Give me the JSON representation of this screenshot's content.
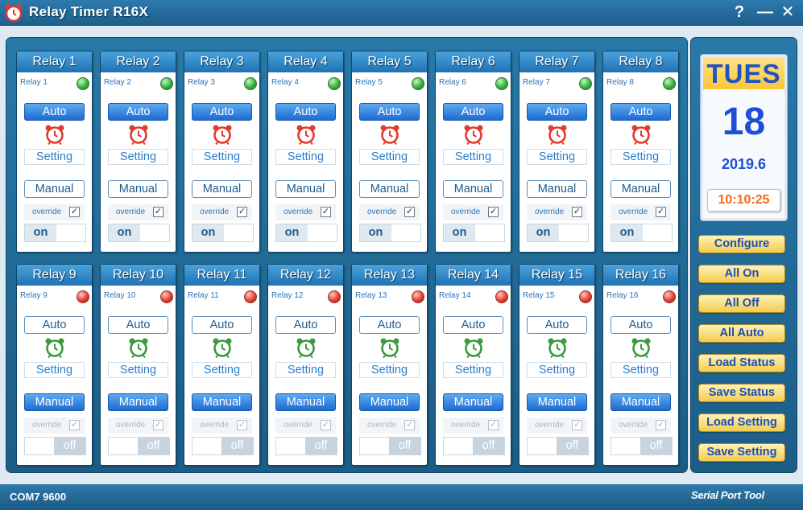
{
  "window": {
    "title": "Relay Timer R16X",
    "help": "?",
    "minimize": "—",
    "close": "✕"
  },
  "relays": [
    {
      "title": "Relay 1",
      "sub": "Relay 1",
      "status": "on",
      "auto": "Auto",
      "setting": "Setting",
      "manual": "Manual",
      "override": "override",
      "override_checked": true,
      "toggle": "on"
    },
    {
      "title": "Relay 2",
      "sub": "Relay 2",
      "status": "on",
      "auto": "Auto",
      "setting": "Setting",
      "manual": "Manual",
      "override": "override",
      "override_checked": true,
      "toggle": "on"
    },
    {
      "title": "Relay 3",
      "sub": "Relay 3",
      "status": "on",
      "auto": "Auto",
      "setting": "Setting",
      "manual": "Manual",
      "override": "override",
      "override_checked": true,
      "toggle": "on"
    },
    {
      "title": "Relay 4",
      "sub": "Relay 4",
      "status": "on",
      "auto": "Auto",
      "setting": "Setting",
      "manual": "Manual",
      "override": "override",
      "override_checked": true,
      "toggle": "on"
    },
    {
      "title": "Relay 5",
      "sub": "Relay 5",
      "status": "on",
      "auto": "Auto",
      "setting": "Setting",
      "manual": "Manual",
      "override": "override",
      "override_checked": true,
      "toggle": "on"
    },
    {
      "title": "Relay 6",
      "sub": "Relay 6",
      "status": "on",
      "auto": "Auto",
      "setting": "Setting",
      "manual": "Manual",
      "override": "override",
      "override_checked": true,
      "toggle": "on"
    },
    {
      "title": "Relay 7",
      "sub": "Relay 7",
      "status": "on",
      "auto": "Auto",
      "setting": "Setting",
      "manual": "Manual",
      "override": "override",
      "override_checked": true,
      "toggle": "on"
    },
    {
      "title": "Relay 8",
      "sub": "Relay 8",
      "status": "on",
      "auto": "Auto",
      "setting": "Setting",
      "manual": "Manual",
      "override": "override",
      "override_checked": true,
      "toggle": "on"
    },
    {
      "title": "Relay 9",
      "sub": "Relay 9",
      "status": "off",
      "auto": "Auto",
      "setting": "Setting",
      "manual": "Manual",
      "override": "override",
      "override_checked": true,
      "toggle": "off"
    },
    {
      "title": "Relay 10",
      "sub": "Relay 10",
      "status": "off",
      "auto": "Auto",
      "setting": "Setting",
      "manual": "Manual",
      "override": "override",
      "override_checked": true,
      "toggle": "off"
    },
    {
      "title": "Relay 11",
      "sub": "Relay 11",
      "status": "off",
      "auto": "Auto",
      "setting": "Setting",
      "manual": "Manual",
      "override": "override",
      "override_checked": true,
      "toggle": "off"
    },
    {
      "title": "Relay 12",
      "sub": "Relay 12",
      "status": "off",
      "auto": "Auto",
      "setting": "Setting",
      "manual": "Manual",
      "override": "override",
      "override_checked": true,
      "toggle": "off"
    },
    {
      "title": "Relay 13",
      "sub": "Relay 13",
      "status": "off",
      "auto": "Auto",
      "setting": "Setting",
      "manual": "Manual",
      "override": "override",
      "override_checked": true,
      "toggle": "off"
    },
    {
      "title": "Relay 14",
      "sub": "Relay 14",
      "status": "off",
      "auto": "Auto",
      "setting": "Setting",
      "manual": "Manual",
      "override": "override",
      "override_checked": true,
      "toggle": "off"
    },
    {
      "title": "Relay 15",
      "sub": "Relay 15",
      "status": "off",
      "auto": "Auto",
      "setting": "Setting",
      "manual": "Manual",
      "override": "override",
      "override_checked": true,
      "toggle": "off"
    },
    {
      "title": "Relay 16",
      "sub": "Relay 16",
      "status": "off",
      "auto": "Auto",
      "setting": "Setting",
      "manual": "Manual",
      "override": "override",
      "override_checked": true,
      "toggle": "off"
    }
  ],
  "date": {
    "dow": "TUES",
    "day": "18",
    "year_month": "2019.6",
    "time": "10:10:25"
  },
  "actions": [
    "Configure",
    "All On",
    "All Off",
    "All Auto",
    "Load Status",
    "Save Status",
    "Load Setting",
    "Save Setting"
  ],
  "status": {
    "port": "COM7 9600",
    "brand": "Serial Port Tool"
  },
  "colors": {
    "frame": "#1f6a98",
    "led_on": "#32b53e",
    "led_off": "#e84033",
    "accent_blue": "#1d6bd2",
    "action_gold": "#f4cb4d",
    "clock_orange": "#f06a18"
  }
}
